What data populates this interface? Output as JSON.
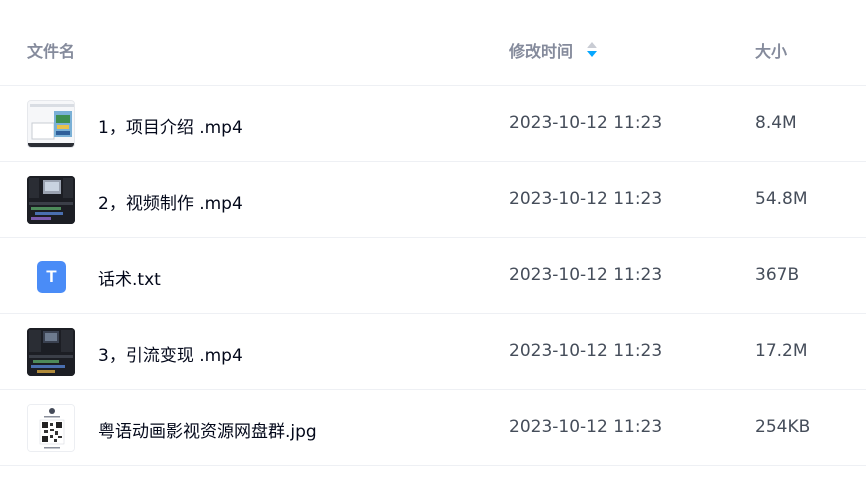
{
  "header": {
    "name_label": "文件名",
    "time_label": "修改时间",
    "size_label": "大小"
  },
  "files": [
    {
      "name": "1，项目介绍 .mp4",
      "time": "2023-10-12 11:23",
      "size": "8.4M",
      "thumb": "video-thumbnail-light"
    },
    {
      "name": "2，视频制作 .mp4",
      "time": "2023-10-12 11:23",
      "size": "54.8M",
      "thumb": "video-thumbnail-dark"
    },
    {
      "name": "话术.txt",
      "time": "2023-10-12 11:23",
      "size": "367B",
      "thumb": "txt-file-icon",
      "icon_letter": "T"
    },
    {
      "name": "3，引流变现 .mp4",
      "time": "2023-10-12 11:23",
      "size": "17.2M",
      "thumb": "video-thumbnail-dark"
    },
    {
      "name": "粤语动画影视资源网盘群.jpg",
      "time": "2023-10-12 11:23",
      "size": "254KB",
      "thumb": "qr-code-image-thumbnail"
    }
  ],
  "colors": {
    "header_text": "#858b9c",
    "sort_active": "#06a7ff",
    "txt_icon": "#4a8cf7",
    "divider": "#eef0f4"
  }
}
